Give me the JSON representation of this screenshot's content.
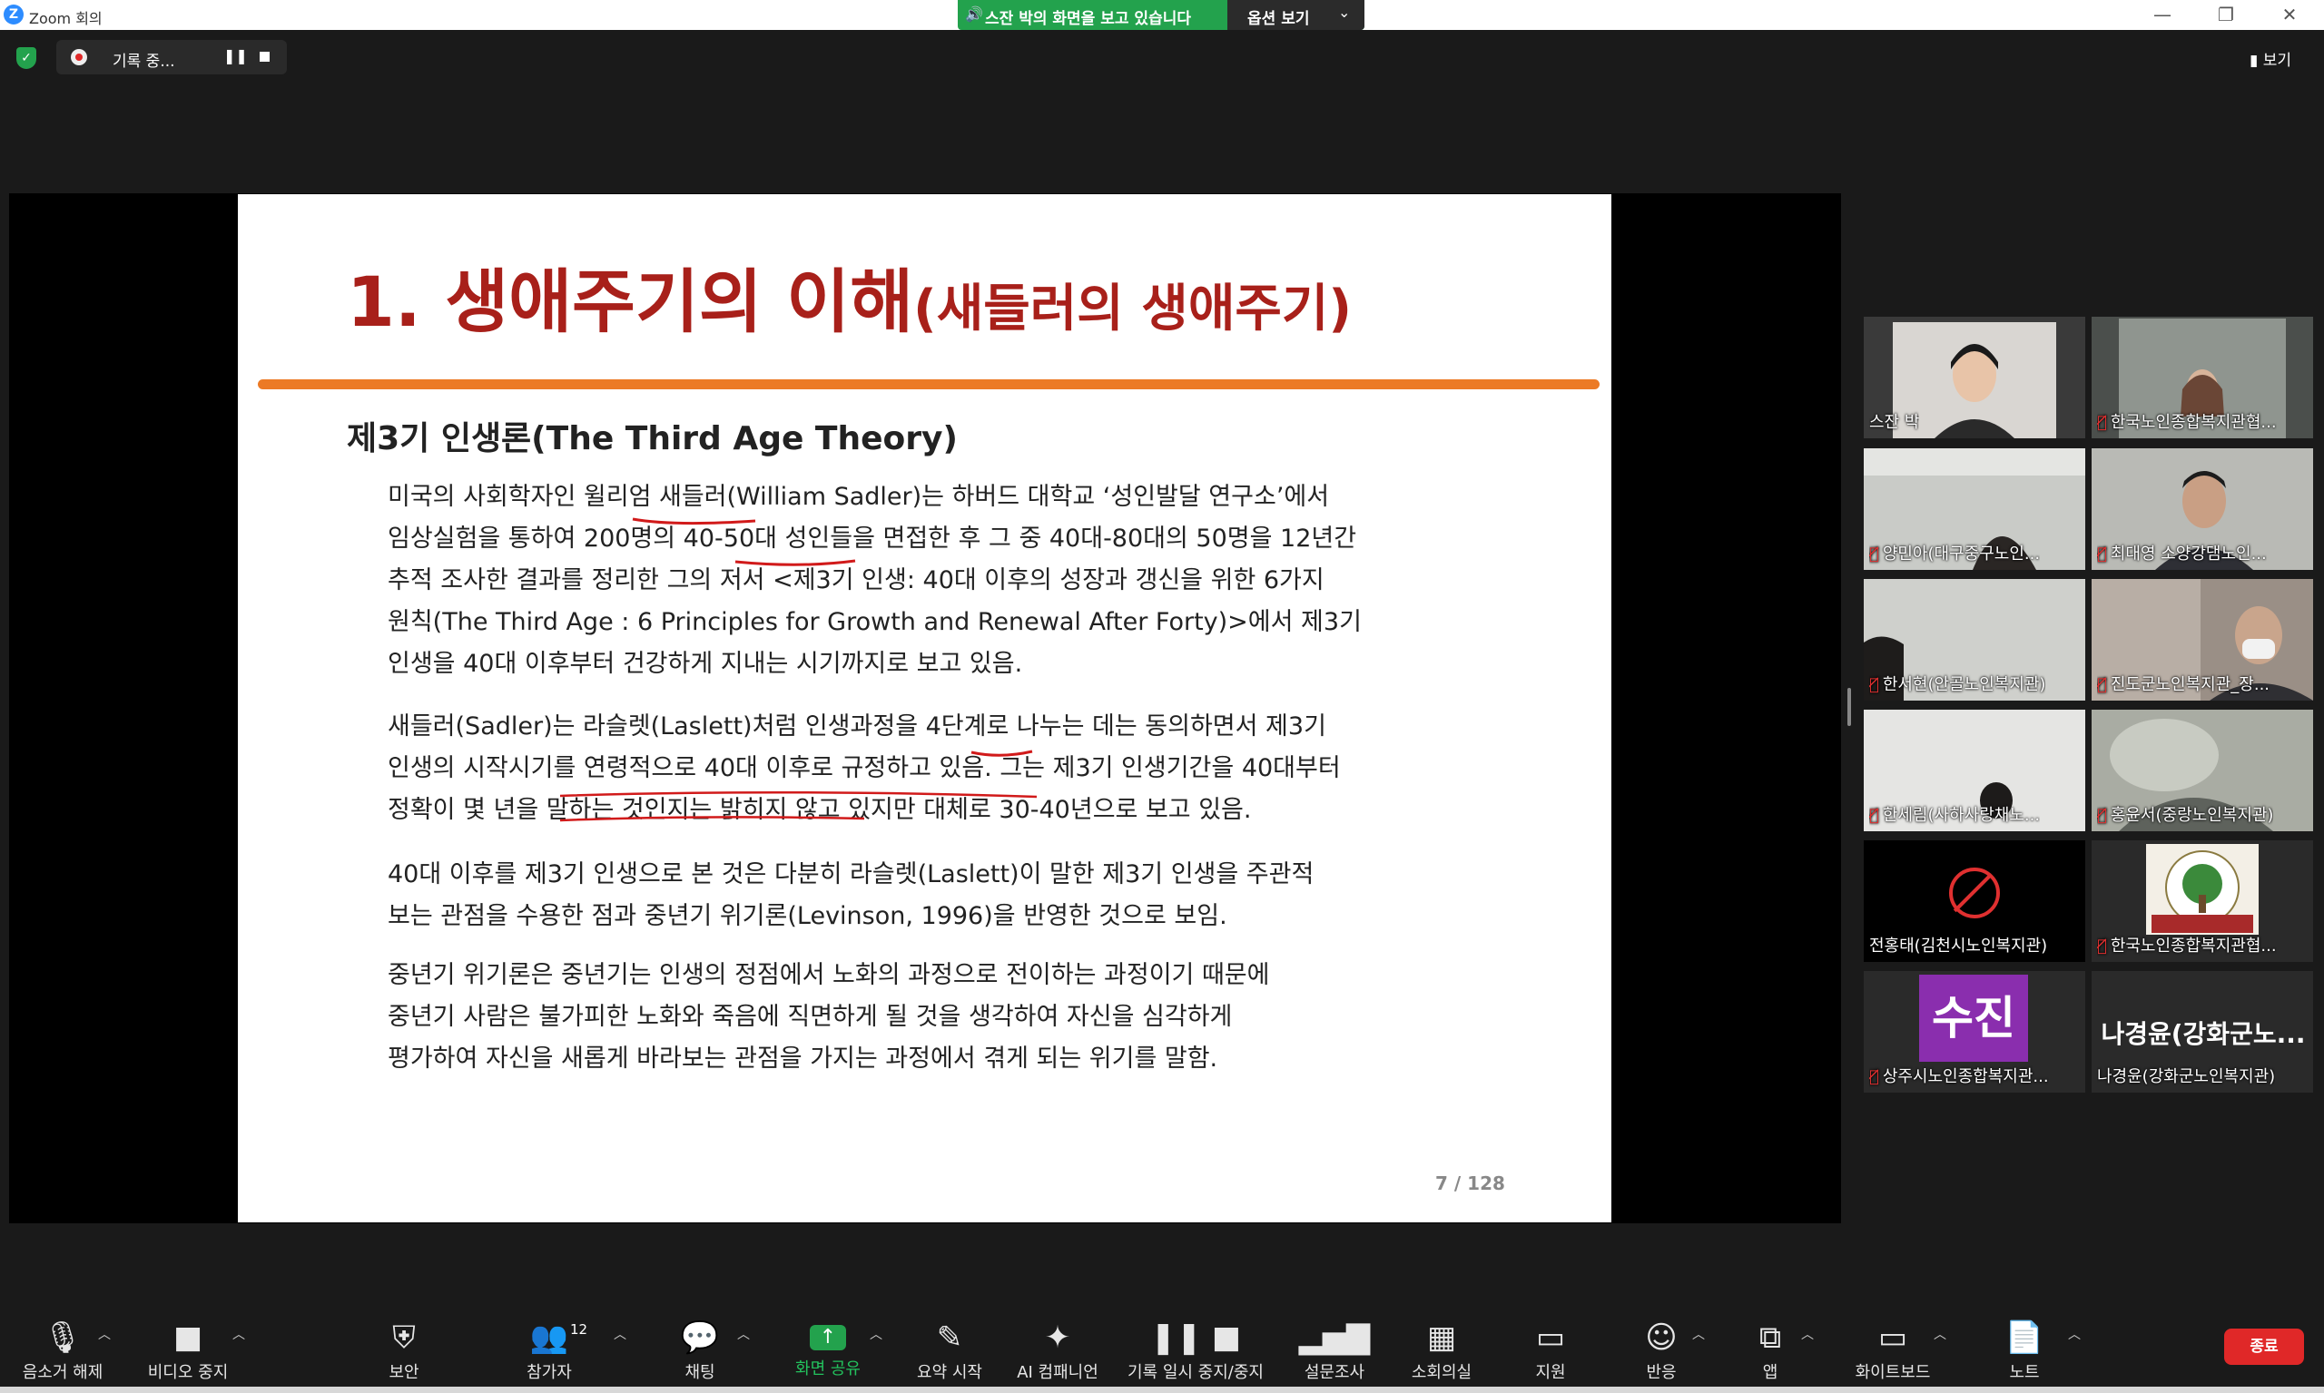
{
  "window": {
    "logo": "Z",
    "title": "Zoom 회의",
    "controls": [
      "—",
      "❐",
      "✕"
    ]
  },
  "share_banner": {
    "text": "스잔 박의 화면을 보고 있습니다",
    "view_options": "옵션 보기",
    "speaker_icon": "speaker-icon",
    "chevron": "⌄"
  },
  "status": {
    "recording_label": "기록 중...",
    "pause_symbol": "❚❚",
    "view_label": "보기",
    "security_shield_color": "#23a24d"
  },
  "slide": {
    "title_main": "1. 생애주기의 이해",
    "title_sub": "(새들러의 생애주기)",
    "subheading": "제3기 인생론(The Third Age Theory)",
    "paragraphs": [
      {
        "lines": [
          "미국의 사회학자인 윌리엄 새들러(William Sadler)는 하버드 대학교 ‘성인발달 연구소’에서",
          "임상실험을 통하여 200명의 40-50대 성인들을 면접한 후 그 중 40대-80대의 50명을 12년간",
          "추적 조사한 결과를 정리한 그의 저서 <제3기 인생: 40대 이후의 성장과 갱신을 위한 6가지",
          "원칙(The Third Age : 6 Principles for Growth and Renewal After Forty)>에서 제3기",
          "인생을 40대 이후부터 건강하게 지내는 시기까지로 보고 있음."
        ]
      },
      {
        "lines": [
          "새들러(Sadler)는 라슬렛(Laslett)처럼 인생과정을 4단계로 나누는 데는 동의하면서 제3기",
          "인생의 시작시기를 연령적으로 40대 이후로 규정하고 있음. 그는 제3기 인생기간을 40대부터",
          "정확이 몇 년을 말하는 것인지는 밝히지 않고 있지만 대체로 30-40년으로 보고 있음."
        ]
      },
      {
        "lines": [
          "40대 이후를 제3기 인생으로 본 것은 다분히 라슬렛(Laslett)이 말한 제3기 인생을 주관적",
          "보는 관점을 수용한 점과 중년기 위기론(Levinson, 1996)을 반영한 것으로 보임."
        ]
      },
      {
        "lines": [
          "중년기 위기론은 중년기는 인생의 정점에서 노화의 과정으로 전이하는 과정이기 때문에",
          "중년기 사람은 불가피한 노화와 죽음에 직면하게 될 것을 생각하여 자신을 심각하게",
          "평가하여 자신을 새롭게 바라보는 관점을 가지는 과정에서 겪게 되는 위기를 말함."
        ]
      }
    ],
    "page_number": "7 / 128",
    "title_color": "#a8201a",
    "rule_color": "#ec7a25",
    "annotation_color": "#d11a1a"
  },
  "participants": [
    {
      "name": "스잔 박",
      "muted": false,
      "active": true,
      "video": "webcam"
    },
    {
      "name": "한국노인종합복지관협...",
      "muted": true,
      "active": false,
      "video": "webcam"
    },
    {
      "name": "양민아(대구중구노인...",
      "muted": true,
      "active": false,
      "video": "webcam"
    },
    {
      "name": "최대영 소양강댐노인...",
      "muted": true,
      "active": false,
      "video": "webcam"
    },
    {
      "name": "한서현(안골노인복지관)",
      "muted": true,
      "active": false,
      "video": "webcam"
    },
    {
      "name": "진도군노인복지관_장...",
      "muted": true,
      "active": false,
      "video": "webcam"
    },
    {
      "name": "한세림(사하사랑채노...",
      "muted": true,
      "active": false,
      "video": "webcam"
    },
    {
      "name": "홍윤서(중랑노인복지관)",
      "muted": true,
      "active": false,
      "video": "webcam"
    },
    {
      "name": "전홍태(김천시노인복지관)",
      "muted": false,
      "active": false,
      "video": "camera-off"
    },
    {
      "name": "한국노인종합복지관협...",
      "muted": true,
      "active": false,
      "video": "logo"
    },
    {
      "name": "상주시노인종합복지관...",
      "muted": true,
      "active": false,
      "video": "avatar",
      "avatar_text": "수진",
      "avatar_color": "#8a2eae"
    },
    {
      "name": "나경윤(강화군노인복지관)",
      "muted": false,
      "active": false,
      "video": "name-only",
      "display_text": "나경윤(강화군노..."
    }
  ],
  "toolbar": {
    "items": [
      {
        "id": "unmute",
        "label": "음소거 해제",
        "icon": "microphone-muted-icon",
        "glyph": "🎙",
        "caret": true
      },
      {
        "id": "video",
        "label": "비디오 중지",
        "icon": "video-camera-icon",
        "glyph": "■",
        "caret": true
      },
      {
        "id": "security",
        "label": "보안",
        "icon": "shield-icon",
        "glyph": "⛨",
        "caret": false
      },
      {
        "id": "participants",
        "label": "참가자",
        "icon": "participants-icon",
        "glyph": "👥",
        "caret": true,
        "badge": "12"
      },
      {
        "id": "chat",
        "label": "채팅",
        "icon": "chat-icon",
        "glyph": "💬",
        "caret": true
      },
      {
        "id": "share",
        "label": "화면 공유",
        "icon": "share-screen-icon",
        "glyph": "↑",
        "caret": true
      },
      {
        "id": "summary",
        "label": "요약 시작",
        "icon": "summary-icon",
        "glyph": "✎",
        "caret": false
      },
      {
        "id": "ai",
        "label": "AI 컴패니언",
        "icon": "ai-sparkle-icon",
        "glyph": "✦",
        "caret": false
      },
      {
        "id": "record",
        "label": "기록 일시 중지/중지",
        "icon": "record-pause-stop-icon",
        "glyph": "❚❚ ■",
        "caret": false
      },
      {
        "id": "poll",
        "label": "설문조사",
        "icon": "poll-chart-icon",
        "glyph": "▂▅▇",
        "caret": false
      },
      {
        "id": "breakout",
        "label": "소회의실",
        "icon": "breakout-rooms-icon",
        "glyph": "▦",
        "caret": false
      },
      {
        "id": "support",
        "label": "지원",
        "icon": "support-icon",
        "glyph": "▭",
        "caret": false
      },
      {
        "id": "reactions",
        "label": "반응",
        "icon": "reaction-emoji-icon",
        "glyph": "☺",
        "caret": true
      },
      {
        "id": "apps",
        "label": "앱",
        "icon": "apps-icon",
        "glyph": "⧉",
        "caret": true
      },
      {
        "id": "whiteboard",
        "label": "화이트보드",
        "icon": "whiteboard-icon",
        "glyph": "▭",
        "caret": true
      },
      {
        "id": "notes",
        "label": "노트",
        "icon": "notes-icon",
        "glyph": "📄",
        "caret": true
      }
    ],
    "end_label": "종료",
    "end_color": "#e02828"
  }
}
